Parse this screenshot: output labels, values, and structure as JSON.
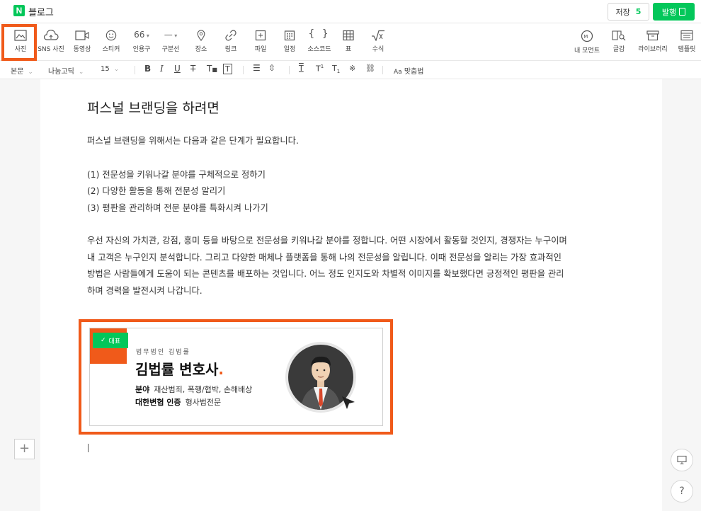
{
  "header": {
    "logo_letter": "N",
    "title": "블로그",
    "save_label": "저장",
    "save_count": "5",
    "publish_label": "발행"
  },
  "toolbar": {
    "items": [
      {
        "label": "사진",
        "icon": "image-icon"
      },
      {
        "label": "SNS 사진",
        "icon": "cloud-icon"
      },
      {
        "label": "동영상",
        "icon": "video-icon"
      },
      {
        "label": "스티커",
        "icon": "smile-icon"
      },
      {
        "label": "인용구",
        "icon": "quote-icon"
      },
      {
        "label": "구분선",
        "icon": "divider-icon"
      },
      {
        "label": "장소",
        "icon": "pin-icon"
      },
      {
        "label": "링크",
        "icon": "link-icon"
      },
      {
        "label": "파일",
        "icon": "file-icon"
      },
      {
        "label": "일정",
        "icon": "calendar-icon"
      },
      {
        "label": "소스코드",
        "icon": "code-icon"
      },
      {
        "label": "표",
        "icon": "table-icon"
      },
      {
        "label": "수식",
        "icon": "formula-icon"
      },
      {
        "label": "내 모먼트",
        "icon": "moment-icon"
      },
      {
        "label": "글감",
        "icon": "search-book-icon"
      },
      {
        "label": "라이브러리",
        "icon": "library-icon"
      },
      {
        "label": "템플릿",
        "icon": "template-icon"
      }
    ],
    "quote_glyph": "66"
  },
  "format": {
    "style": "본문",
    "font": "나눔고딕",
    "size": "15",
    "spellcheck": "맞춤법"
  },
  "document": {
    "title": "퍼스널 브랜딩을 하려면",
    "intro": "퍼스널 브랜딩을 위해서는 다음과 같은 단계가 필요합니다.",
    "steps": [
      "(1) 전문성을 키워나갈 분야를 구체적으로 정하기",
      "(2) 다양한 활동을 통해 전문성 알리기",
      "(3) 평판을 관리하며 전문 분야를 특화시켜 나가기"
    ],
    "body_lines": [
      "우선 자신의 가치관, 강점, 흥미 등을 바탕으로 전문성을 키워나갈 분야를 정합니다. 어떤 시장에서 활동할 것인지, 경쟁자는 누구이며",
      "내 고객은 누구인지 분석합니다. 그리고 다양한 매체나 플랫폼을 통해 나의 전문성을 알립니다. 이때 전문성을 알리는 가장 효과적인",
      "방법은 사람들에게 도움이 되는 콘텐츠를 배포하는 것입니다. 어느 정도 인지도와 차별적 이미지를 확보했다면 긍정적인 평판을 관리",
      "하며 경력을 발전시켜 나갑니다."
    ]
  },
  "banner": {
    "badge": "대표",
    "firm": "법무법인 김법률",
    "name": "김법률 변호사",
    "name_dot": ".",
    "field_key": "분야",
    "field_value": "재산범죄, 폭행/협박, 손해배상",
    "cert_key": "대한변협 인증",
    "cert_value": "형사법전문"
  },
  "side": {
    "plus": "+",
    "help": "?"
  },
  "colors": {
    "brand_green": "#03c75a",
    "highlight_orange": "#f05a1a"
  }
}
